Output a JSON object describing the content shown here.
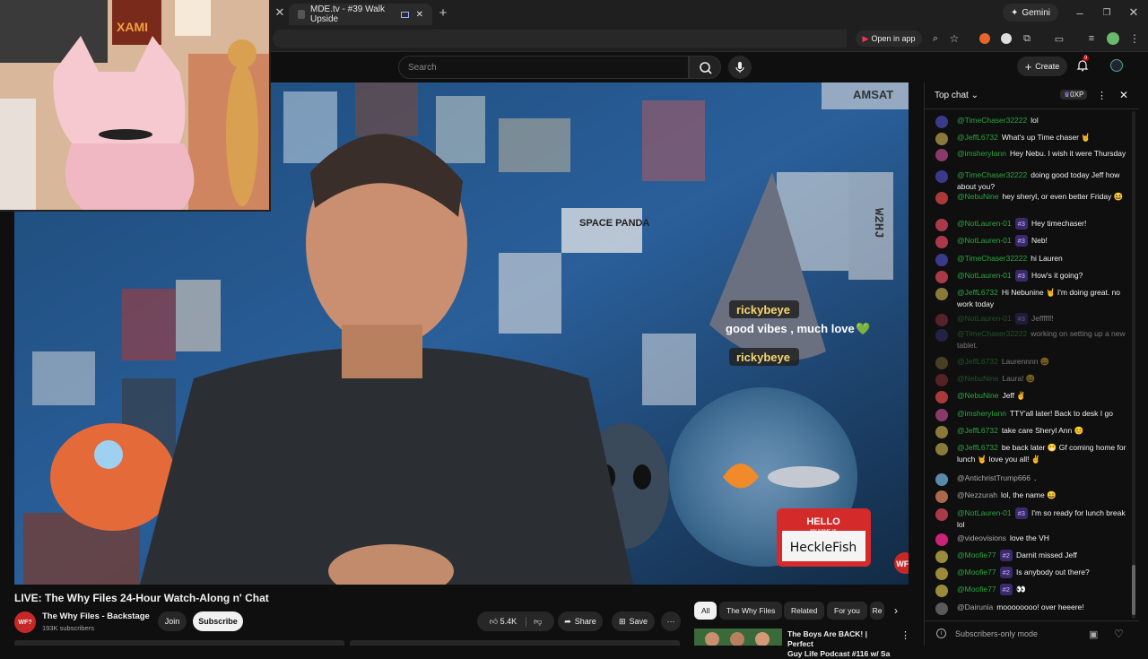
{
  "browser": {
    "tab_title": "MDE.tv - #39 Walk Upside",
    "gemini_label": "Gemini",
    "open_in_app": "Open in app"
  },
  "header": {
    "search_placeholder": "Search",
    "create_label": "Create",
    "notification_count": "9"
  },
  "video": {
    "overlay": {
      "name1": "rickybeye",
      "message1": "good vibes , much love",
      "name2": "rickybeye",
      "heart": "💚"
    },
    "sign_line1": "HELLO",
    "sign_line2": "MY NAME IS",
    "sign_name": "HeckleFish",
    "poster_text": "SPACE PANDA",
    "watermark": "WF?",
    "letters_right": "W2HJ",
    "letters_top": "AMSAT",
    "poster_left": "XAMI"
  },
  "title": "LIVE: The Why Files 24-Hour Watch-Along n' Chat",
  "channel": {
    "avatar_text": "WF?",
    "name": "The Why Files - Backstage",
    "subscribers": "193K subscribers",
    "join": "Join",
    "subscribe": "Subscribe"
  },
  "actions": {
    "likes": "5.4K",
    "share": "Share",
    "save": "Save"
  },
  "chips": [
    "All",
    "The Why Files",
    "Related",
    "For you",
    "Re"
  ],
  "recommend": {
    "title1": "The Boys Are BACK! | Perfect",
    "title2": "Guy Life Podcast #116 w/ Sa"
  },
  "chat": {
    "header": "Top chat",
    "xp": "0XP",
    "footer": "Subscribers-only mode",
    "messages": [
      {
        "name": "@TimeChaser32222",
        "badge": "",
        "text": "lol",
        "color": "#3a3a8a"
      },
      {
        "name": "@JeffL6732",
        "badge": "",
        "text": "What's up Time chaser 🤘",
        "color": "#8a7a3a"
      },
      {
        "name": "@imsheryIann",
        "badge": "",
        "text": "Hey Nebu. I wish it were Thursday",
        "color": "#8a3a6a"
      },
      {
        "name": "@TimeChaser32222",
        "badge": "",
        "text": "doing good today Jeff how about you?",
        "color": "#3a3a8a"
      },
      {
        "name": "@NebuNine",
        "badge": "",
        "text": "hey sheryl, or even better Friday 😆",
        "color": "#aa3a3a"
      },
      {
        "name": "@NotLauren-01",
        "badge": "#3",
        "text": "Hey timechaser!",
        "color": "#aa3a4a"
      },
      {
        "name": "@NotLauren-01",
        "badge": "#3",
        "text": "Neb!",
        "color": "#aa3a4a"
      },
      {
        "name": "@TimeChaser32222",
        "badge": "",
        "text": "hi Lauren",
        "color": "#3a3a8a"
      },
      {
        "name": "@NotLauren-01",
        "badge": "#3",
        "text": "How's it going?",
        "color": "#aa3a4a"
      },
      {
        "name": "@JeffL6732",
        "badge": "",
        "text": "Hi Nebunine 🤘 I'm doing great. no work today",
        "color": "#8a7a3a"
      },
      {
        "name": "@NotLauren-01",
        "badge": "#3",
        "text": "Jeffffff!",
        "color": "#aa3a4a"
      },
      {
        "name": "@TimeChaser32222",
        "badge": "",
        "text": "working on setting up a new tablet.",
        "color": "#3a3a8a"
      },
      {
        "name": "@JeffL6732",
        "badge": "",
        "text": "Laurennnn 😄",
        "color": "#8a7a3a"
      },
      {
        "name": "@NebuNine",
        "badge": "",
        "text": "Laura! 😆",
        "color": "#aa3a3a"
      },
      {
        "name": "@NebuNine",
        "badge": "",
        "text": "Jeff ✌",
        "color": "#aa3a3a"
      },
      {
        "name": "@imsheryIann",
        "badge": "",
        "text": "TTY'all later! Back to desk I go",
        "color": "#8a3a6a"
      },
      {
        "name": "@JeffL6732",
        "badge": "",
        "text": "take care Sheryl Ann 😊",
        "color": "#8a7a3a"
      },
      {
        "name": "@JeffL6732",
        "badge": "",
        "text": "be back later 😁 Gf coming home for lunch 🤘 love you all! ✌",
        "color": "#8a7a3a"
      },
      {
        "name": "@AntichristTrump666",
        "badge": "",
        "text": ".",
        "color": "#5a8aaa"
      },
      {
        "name": "@Nezzurah",
        "badge": "",
        "text": "lol, the name 😄",
        "color": "#aa6a4a"
      },
      {
        "name": "@NotLauren-01",
        "badge": "#3",
        "text": "I'm so ready for lunch break lol",
        "color": "#aa3a4a"
      },
      {
        "name": "@videovisions",
        "badge": "",
        "text": "love the VH",
        "color": "#cc2277"
      },
      {
        "name": "@Moofie77",
        "badge": "#2",
        "text": "Darnit missed Jeff",
        "color": "#9a8a3a"
      },
      {
        "name": "@Moofie77",
        "badge": "#2",
        "text": "Is anybody out there?",
        "color": "#9a8a3a"
      },
      {
        "name": "@Moofie77",
        "badge": "#2",
        "text": "👀",
        "color": "#9a8a3a"
      },
      {
        "name": "@Dairunia",
        "badge": "",
        "text": "moooooooo! over heeere!",
        "color": "#5a5a5a"
      }
    ]
  }
}
